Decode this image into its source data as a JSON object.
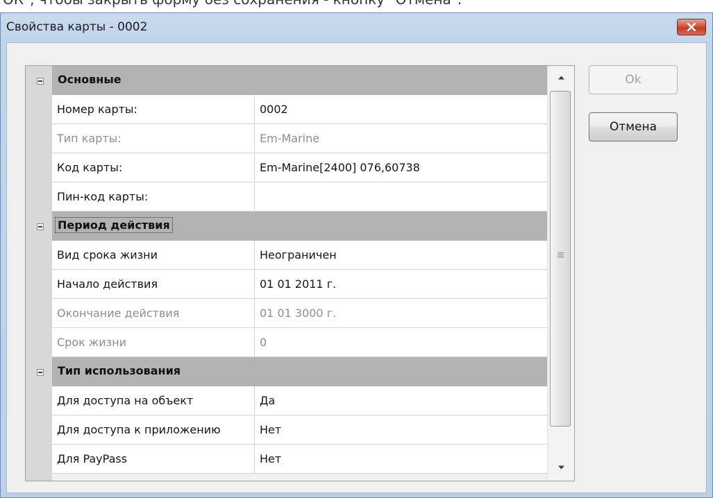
{
  "caption": "ОК\", чтобы закрыть форму без сохранения - кнопку \"Отмена\".",
  "window": {
    "title": "Свойства карты - 0002",
    "close_icon": "close-x-icon"
  },
  "buttons": {
    "ok_label": "Ok",
    "ok_enabled": false,
    "cancel_label": "Отмена"
  },
  "categories": [
    {
      "label": "Основные",
      "expanded": true,
      "properties": [
        {
          "name": "Номер карты:",
          "value": "0002",
          "readonly": false
        },
        {
          "name": "Тип карты:",
          "value": "Em-Marine",
          "readonly": true
        },
        {
          "name": "Код карты:",
          "value": "Em-Marine[2400] 076,60738",
          "readonly": false
        },
        {
          "name": "Пин-код карты:",
          "value": "",
          "readonly": false
        }
      ]
    },
    {
      "label": "Период действия",
      "expanded": true,
      "focused": true,
      "properties": [
        {
          "name": "Вид срока жизни",
          "value": "Неограничен",
          "readonly": false
        },
        {
          "name": "Начало действия",
          "value": "01 01 2011 г.",
          "readonly": false
        },
        {
          "name": "Окончание действия",
          "value": "01 01 3000 г.",
          "readonly": true
        },
        {
          "name": "Срок жизни",
          "value": "0",
          "readonly": true
        }
      ]
    },
    {
      "label": "Тип использования",
      "expanded": true,
      "properties": [
        {
          "name": "Для доступа на объект",
          "value": "Да",
          "readonly": false
        },
        {
          "name": "Для доступа к приложению",
          "value": "Нет",
          "readonly": false
        },
        {
          "name": "Для PayPass",
          "value": "Нет",
          "readonly": false
        }
      ]
    }
  ],
  "colors": {
    "category_fill": "#b3b3b3",
    "disabled_text": "#8d8d8d",
    "close_button": "#c23a22"
  }
}
